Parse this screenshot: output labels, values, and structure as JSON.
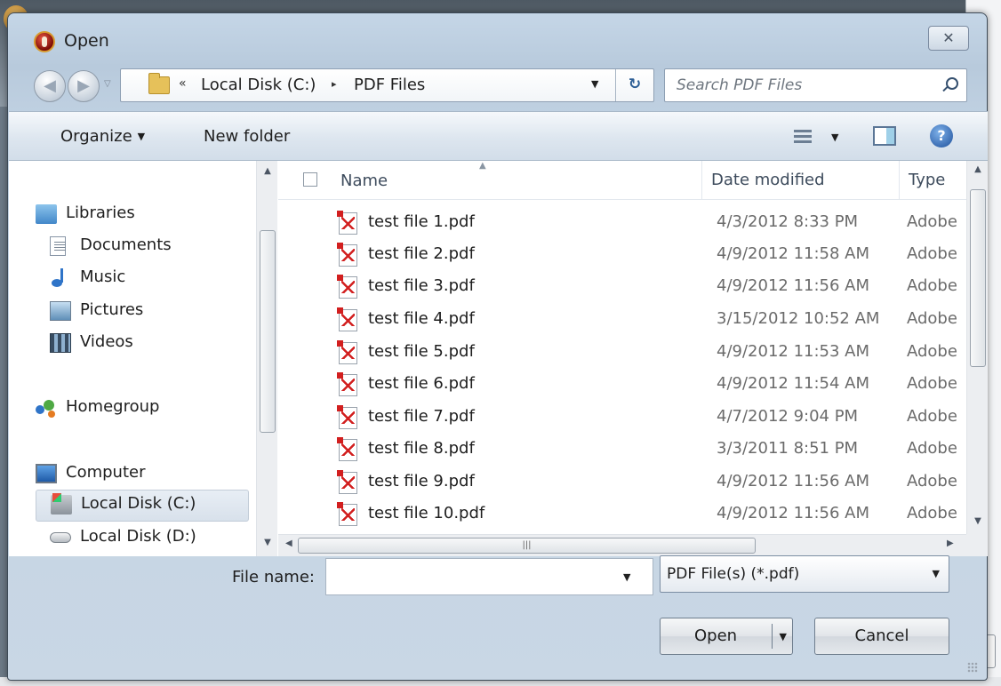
{
  "dialog": {
    "title": "Open",
    "close_glyph": "✕"
  },
  "nav": {
    "breadcrumb_chevron": "«",
    "path": [
      "Local Disk (C:)",
      "PDF Files"
    ],
    "separator": "▸",
    "search_placeholder": "Search PDF Files"
  },
  "toolbar": {
    "organize_label": "Organize",
    "new_folder_label": "New folder"
  },
  "sidebar": {
    "libraries": "Libraries",
    "documents": "Documents",
    "music": "Music",
    "pictures": "Pictures",
    "videos": "Videos",
    "homegroup": "Homegroup",
    "computer": "Computer",
    "disk_c": "Local Disk (C:)",
    "disk_d": "Local Disk (D:)"
  },
  "file_list": {
    "columns": {
      "name": "Name",
      "date": "Date modified",
      "type": "Type"
    },
    "rows": [
      {
        "name": "test file 1.pdf",
        "date": "4/3/2012 8:33 PM",
        "type": "Adobe"
      },
      {
        "name": "test file 2.pdf",
        "date": "4/9/2012 11:58 AM",
        "type": "Adobe"
      },
      {
        "name": "test file 3.pdf",
        "date": "4/9/2012 11:56 AM",
        "type": "Adobe"
      },
      {
        "name": "test file 4.pdf",
        "date": "3/15/2012 10:52 AM",
        "type": "Adobe"
      },
      {
        "name": "test file 5.pdf",
        "date": "4/9/2012 11:53 AM",
        "type": "Adobe"
      },
      {
        "name": "test file 6.pdf",
        "date": "4/9/2012 11:54 AM",
        "type": "Adobe"
      },
      {
        "name": "test file 7.pdf",
        "date": "4/7/2012 9:04 PM",
        "type": "Adobe"
      },
      {
        "name": "test file 8.pdf",
        "date": "3/3/2011 8:51 PM",
        "type": "Adobe"
      },
      {
        "name": "test file 9.pdf",
        "date": "4/9/2012 11:56 AM",
        "type": "Adobe"
      },
      {
        "name": "test file 10.pdf",
        "date": "4/9/2012 11:56 AM",
        "type": "Adobe"
      }
    ]
  },
  "bottom": {
    "file_name_label": "File name:",
    "file_name_value": "",
    "filter_value": "PDF File(s) (*.pdf)",
    "open_label": "Open",
    "cancel_label": "Cancel"
  }
}
